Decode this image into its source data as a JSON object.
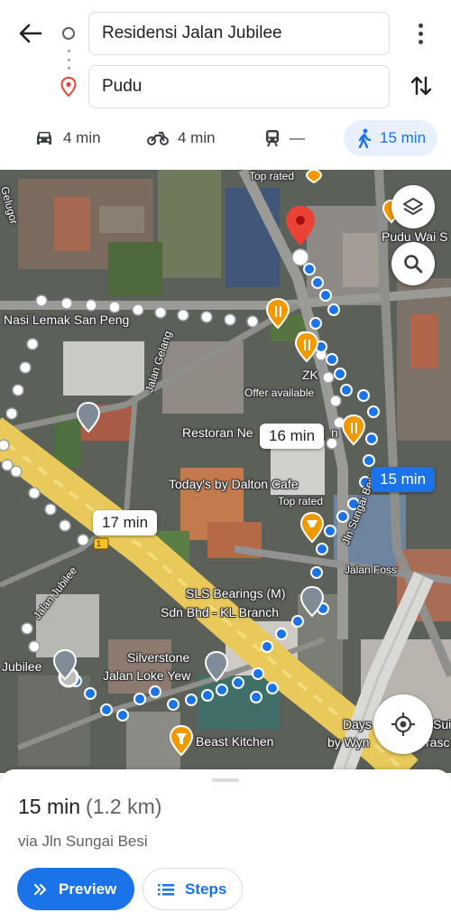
{
  "header": {
    "origin": "Residensi Jalan Jubilee",
    "destination": "Pudu",
    "modes": [
      {
        "icon": "car-icon",
        "label": "4 min"
      },
      {
        "icon": "motorcycle-icon",
        "label": "4 min"
      },
      {
        "icon": "train-icon",
        "label": "—"
      },
      {
        "icon": "walk-icon",
        "label": "15 min",
        "selected": true
      }
    ]
  },
  "map": {
    "labels": {
      "top_rated_top": "Top rated",
      "pudu_wai": "Pudu Wai S",
      "geluger": "Gelugor",
      "nasi_lemak": "Nasi Lemak San Peng",
      "jalan_gelang": "Jalan Gelang",
      "zk": "ZK",
      "offer": "Offer available",
      "restoran": "Restoran Ne",
      "restoran_tail": "n",
      "todays": "Today's by Dalton Cafe",
      "top_rated_mid": "Top rated",
      "jln_sungai": "Jln Sungai Besi",
      "jalan_foss": "Jalan Foss",
      "sls_1": "SLS Bearings (M)",
      "sls_2": "Sdn Bhd - KL Branch",
      "jalan_jubilee": "Jalan Jubilee",
      "jubilee": "Jubilee",
      "silverstone_1": "Silverstone",
      "silverstone_2": "Jalan Loke Yew",
      "beast": "Beast Kitchen",
      "days_1": "Days",
      "days_1b": "Sui",
      "days_2": "by Wyn",
      "days_2b": "rasc",
      "route_marker": "1"
    },
    "bubbles": {
      "alt1": "16 min",
      "alt2": "17 min",
      "selected": "15 min"
    }
  },
  "sheet": {
    "duration": "15 min",
    "distance": "(1.2 km)",
    "via": "via Jln Sungai Besi",
    "preview_label": "Preview",
    "steps_label": "Steps"
  },
  "colors": {
    "accent": "#1a73e8",
    "pin": "#ea4335",
    "food_poi": "#f29900",
    "road_highlight": "#e8c95a"
  }
}
